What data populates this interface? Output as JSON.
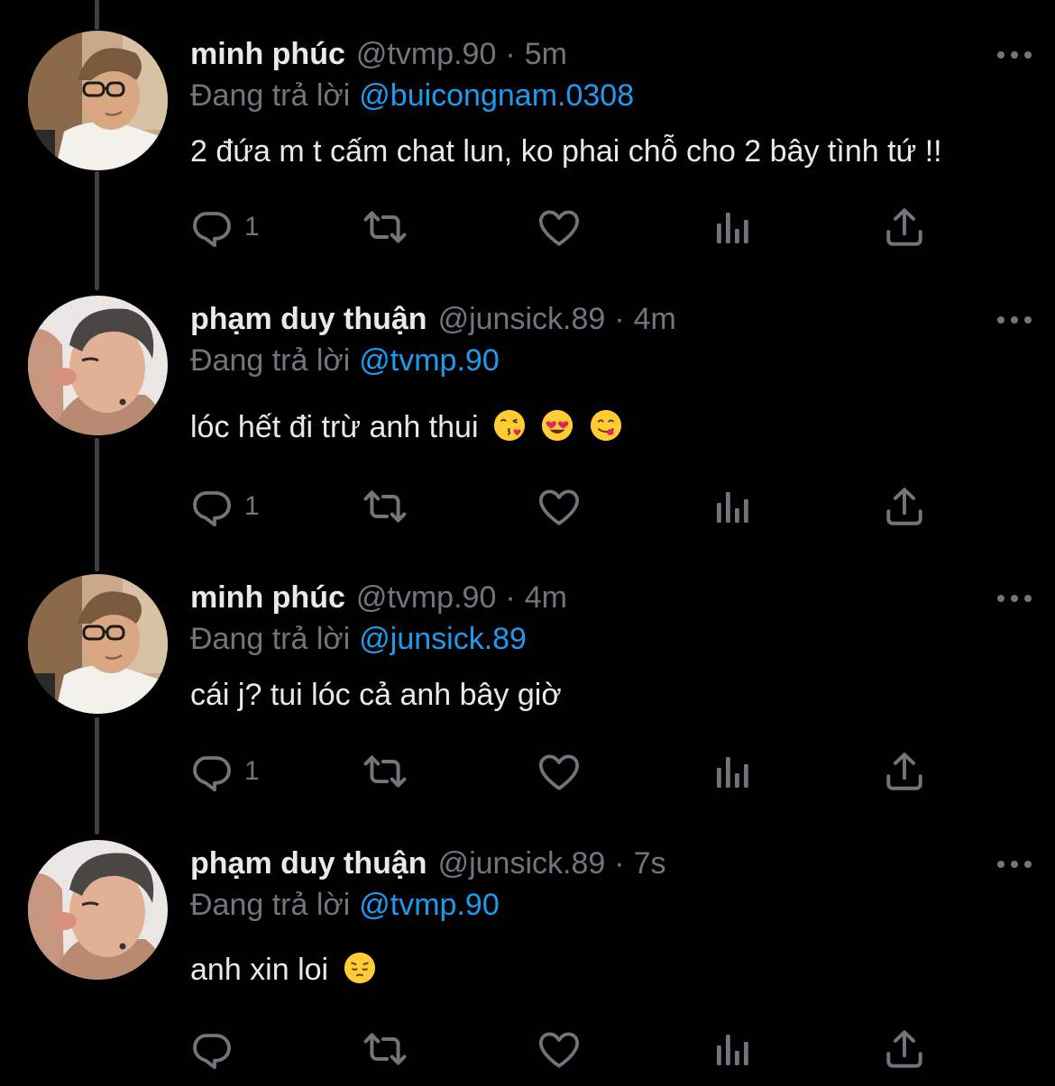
{
  "colors": {
    "background": "#000000",
    "text": "#e7e9ea",
    "muted": "#71767b",
    "accent": "#1d9bf0",
    "thread_line": "#3e4144"
  },
  "replying_label": "Đang trả lời",
  "tweets": [
    {
      "name": "minh phúc",
      "handle": "@tvmp.90",
      "separator": "·",
      "time": "5m",
      "reply_to": "@buicongnam.0308",
      "text": "2 đứa m t cấm chat lun, ko phai chỗ cho 2 bây tình tứ !!",
      "reply_count": "1",
      "emojis": []
    },
    {
      "name": "phạm duy thuận",
      "handle": "@junsick.89",
      "separator": "·",
      "time": "4m",
      "reply_to": "@tvmp.90",
      "text": "lóc hết đi trừ anh thui",
      "reply_count": "1",
      "emojis": [
        "face-blowing-kiss-emoji",
        "heart-eyes-emoji",
        "yum-face-emoji"
      ]
    },
    {
      "name": "minh phúc",
      "handle": "@tvmp.90",
      "separator": "·",
      "time": "4m",
      "reply_to": "@junsick.89",
      "text": "cái j? tui lóc cả anh bây giờ",
      "reply_count": "1",
      "emojis": []
    },
    {
      "name": "phạm duy thuận",
      "handle": "@junsick.89",
      "separator": "·",
      "time": "7s",
      "reply_to": "@tvmp.90",
      "text": "anh xin loi",
      "reply_count": "",
      "emojis": [
        "pensive-face-emoji"
      ]
    }
  ]
}
